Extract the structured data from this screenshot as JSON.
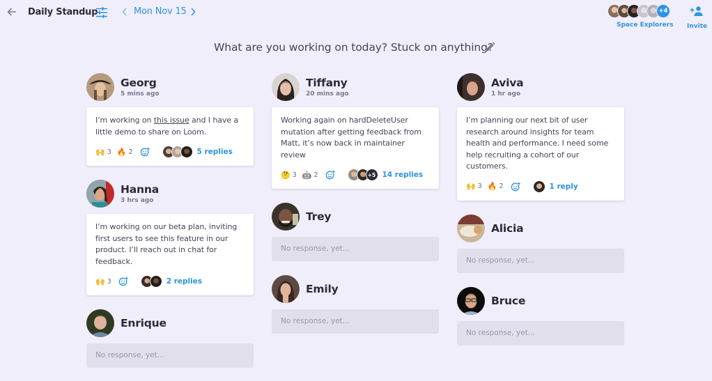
{
  "header": {
    "title": "Daily Standup",
    "date": "Mon Nov 15",
    "team": {
      "name": "Space Explorers",
      "extra_members": "+4",
      "avatar_colors": [
        "#8a6f5c",
        "#6d5a4a",
        "#3d2e26",
        "#c8c4cf",
        "#b7b0bd"
      ]
    },
    "invite_label": "Invite"
  },
  "colors": {
    "accent": "#2e93e0",
    "background": "#f0eefa",
    "empty_card": "#e0dfeb"
  },
  "question": "What are you working on today? Stuck on anything?",
  "empty_text": "No response, yet...",
  "responses": {
    "georg": {
      "name": "Georg",
      "time": "5 mins ago",
      "text_before": "I’m working on ",
      "link": "this issue",
      "text_after": " and I have a little demo to share on Loom.",
      "reactions": [
        {
          "emoji": "🙌",
          "count": "3"
        },
        {
          "emoji": "🔥",
          "count": "2"
        }
      ],
      "replies": "5 replies"
    },
    "hanna": {
      "name": "Hanna",
      "time": "3 hrs ago",
      "text": "I’m working on our beta plan, inviting first users to see this feature in our product. I’ll reach out in chat for feedback.",
      "reactions": [
        {
          "emoji": "🙌",
          "count": "3"
        }
      ],
      "replies": "2 replies"
    },
    "enrique": {
      "name": "Enrique"
    },
    "tiffany": {
      "name": "Tiffany",
      "time": "20 mins ago",
      "text": "Working again on hardDeleteUser mutation after getting feedback from Matt, it’s now back in maintainer review",
      "reactions": [
        {
          "emoji": "🤔",
          "count": "3"
        },
        {
          "emoji": "🤖",
          "count": "2"
        }
      ],
      "more_repliers": "+5",
      "replies": "14 replies"
    },
    "trey": {
      "name": "Trey"
    },
    "emily": {
      "name": "Emily"
    },
    "aviva": {
      "name": "Aviva",
      "time": "1 hr ago",
      "text": "I’m planning our next bit of user research around insights for team health and performance. I need some help recruiting a cohort of our customers.",
      "reactions": [
        {
          "emoji": "🙌",
          "count": "3"
        },
        {
          "emoji": "🔥",
          "count": "2"
        }
      ],
      "replies": "1 reply"
    },
    "alicia": {
      "name": "Alicia"
    },
    "bruce": {
      "name": "Bruce"
    }
  }
}
